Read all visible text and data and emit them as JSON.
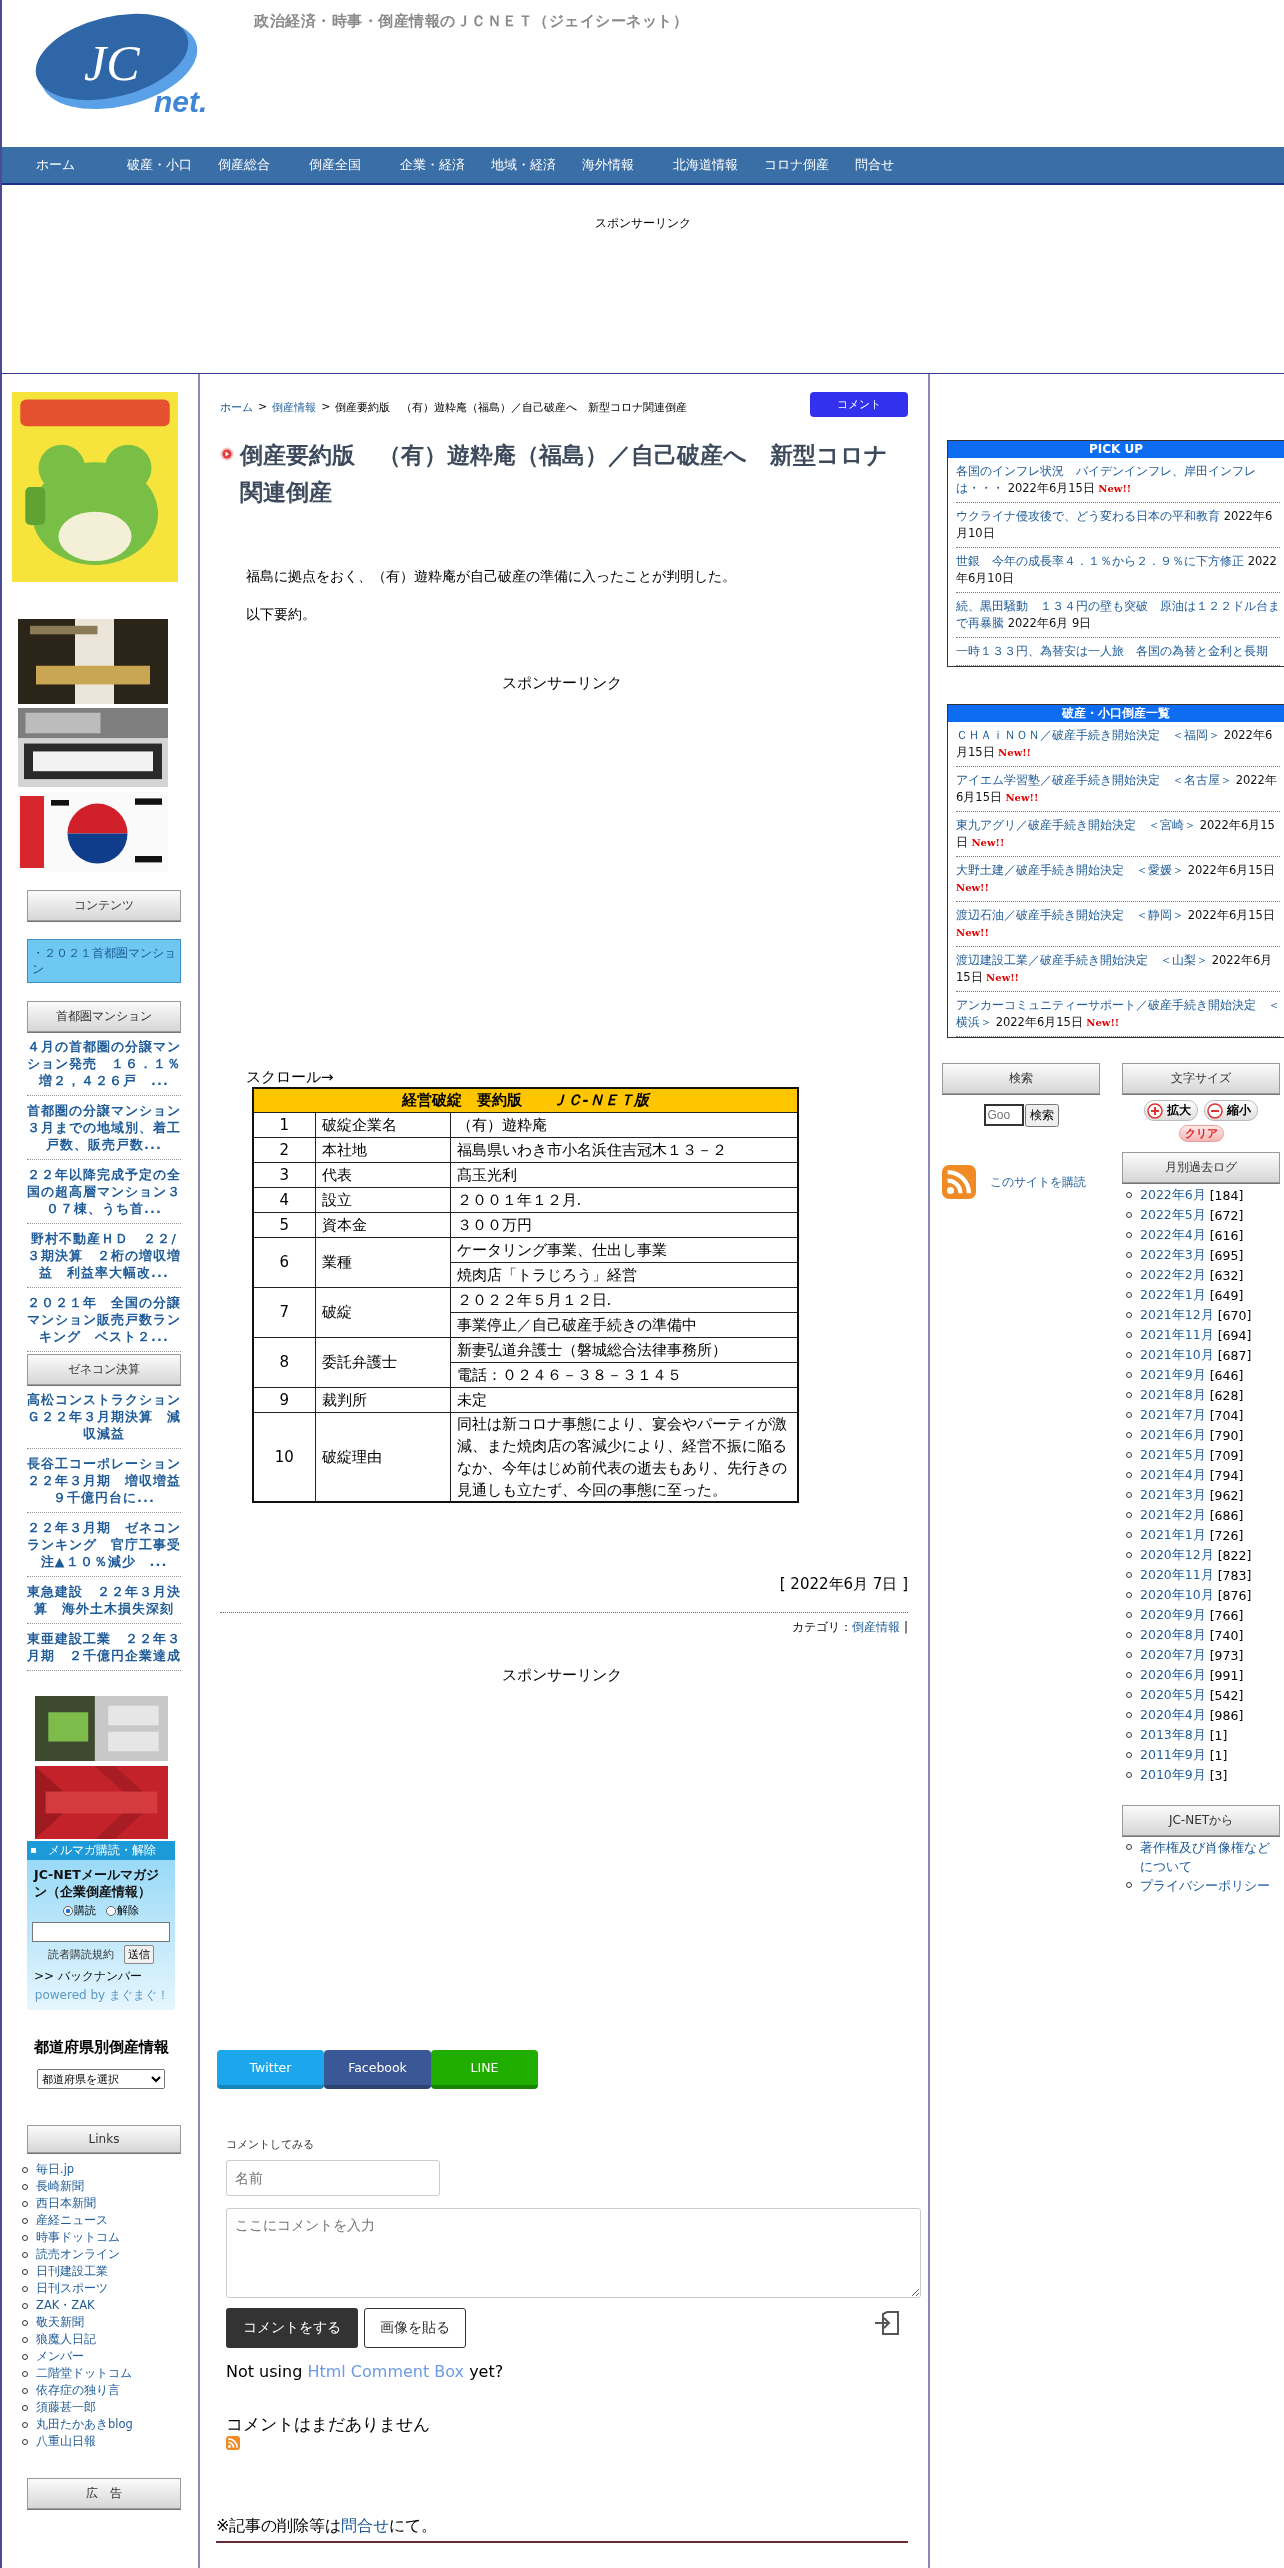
{
  "header": {
    "logo": {
      "mark": "JC",
      "suffix": "net."
    },
    "tagline": "政治経済・時事・倒産情報のＪＣＮＥＴ（ジェイシーネット）"
  },
  "nav": [
    "ホーム",
    "破産・小口",
    "倒産総合",
    "倒産全国",
    "企業・経済",
    "地域・経済",
    "海外情報",
    "北海道情報",
    "コロナ倒産",
    "問合せ"
  ],
  "top_sponsor": "スポンサーリンク",
  "left_sidebar": {
    "contents": {
      "heading": "コンテンツ",
      "items": [
        "・２０２１首都圏マンション"
      ]
    },
    "mansion": {
      "heading": "首都圏マンション",
      "items": [
        "４月の首都圏の分譲マンション発売　１６．１％増２，４２６戸　...",
        "首都圏の分譲マンション３月までの地域別、着工戸数、販売戸数...",
        "２２年以降完成予定の全国の超高層マンション３０７棟、うち首...",
        "野村不動産ＨＤ　２２/３期決算　２桁の増収増益　利益率大幅改...",
        "２０２１年　全国の分譲マンション販売戸数ランキング　ベスト２..."
      ]
    },
    "zenecon": {
      "heading": "ゼネコン決算",
      "items": [
        "高松コンストラクションＧ２２年３月期決算　減収減益",
        "長谷工コーポレーション２２年３月期　増収増益９千億円台に...",
        "２２年３月期　ゼネコンランキング　官庁工事受注▲１０％減少　...",
        "東急建設　２２年３月決算　海外土木損失深刻",
        "東亜建設工業　２２年３月期　２千億円企業達成"
      ]
    },
    "mailmag": {
      "header": "メルマガ購読・解除",
      "title": "JC-NETメールマガジン（企業倒産情報）",
      "options": [
        {
          "label": "購読",
          "selected": true
        },
        {
          "label": "解除",
          "selected": false
        }
      ],
      "terms": "読者購読規約",
      "submit": "送信",
      "backnumber": ">> バックナンバー",
      "powered_by": "powered by",
      "powered_link": "まぐまぐ！"
    },
    "prefecture": {
      "title": "都道府県別倒産情報",
      "select": "都道府県を選択"
    },
    "links": {
      "heading": "Links",
      "items": [
        "毎日.jp",
        "長崎新聞",
        "西日本新聞",
        "産経ニュース",
        "時事ドットコム",
        "読売オンライン",
        "日刊建設工業",
        "日刊スポーツ",
        "ZAK・ZAK",
        "敬天新聞",
        "狼魔人日記",
        "メンバー",
        "二階堂ドットコム",
        "依存症の独り言",
        "須藤甚一郎",
        "丸田たかあきblog",
        "八重山日報"
      ]
    },
    "ad_heading": "広　告"
  },
  "article": {
    "breadcrumb": [
      {
        "kind": "link",
        "text": "ホーム"
      },
      {
        "kind": "separator",
        "text": ">"
      },
      {
        "kind": "link",
        "text": "倒産情報"
      },
      {
        "kind": "separator",
        "text": ">"
      },
      {
        "kind": "current",
        "text": "倒産要約版　（有）遊粋庵（福島）／自己破産へ　新型コロナ関連倒産"
      }
    ],
    "comment_button": "コメント",
    "title": "倒産要約版　（有）遊粋庵（福島）／自己破産へ　新型コロナ関連倒産",
    "paragraphs": [
      "福島に拠点をおく、（有）遊粋庵が自己破産の準備に入ったことが判明した。",
      "以下要約。"
    ],
    "sponsor": "スポンサーリンク",
    "scroll_hint": "スクロール→",
    "table": {
      "caption": "経営破綻　要約版　　*ＪＣ-ＮＥＴ版*",
      "rows": [
        {
          "no": "1",
          "label": "破綻企業名",
          "values": [
            "（有）遊粋庵"
          ]
        },
        {
          "no": "2",
          "label": "本社地",
          "values": [
            "福島県いわき市小名浜住吉冠木１３－２"
          ]
        },
        {
          "no": "3",
          "label": "代表",
          "values": [
            "髙玉光利"
          ]
        },
        {
          "no": "4",
          "label": "設立",
          "values": [
            "２００１年１２月."
          ]
        },
        {
          "no": "5",
          "label": "資本金",
          "values": [
            "３００万円"
          ]
        },
        {
          "no": "6",
          "label": "業種",
          "values": [
            "ケータリング事業、仕出し事業",
            "焼肉店「トラじろう」経営"
          ]
        },
        {
          "no": "7",
          "label": "破綻",
          "values": [
            "２０２２年５月１２日.",
            "事業停止／自己破産手続きの準備中"
          ]
        },
        {
          "no": "8",
          "label": "委託弁護士",
          "values": [
            "新妻弘道弁護士（磐城総合法律事務所）",
            "電話：０２４６－３８－３１４５"
          ]
        },
        {
          "no": "9",
          "label": "裁判所",
          "values": [
            "未定"
          ]
        },
        {
          "no": "10",
          "label": "破綻理由",
          "values": [
            "同社は新コロナ事態により、宴会やパーティが激減、また焼肉店の客減少により、経営不振に陥るなか、今年はじめ前代表の逝去もあり、先行きの見通しも立たず、今回の事態に至った。"
          ]
        }
      ]
    },
    "date": "[ 2022年6月 7日 ]",
    "category": {
      "label": "カテゴリ：",
      "link": "倒産情報",
      "separator": "|"
    },
    "sponsor_bottom": "スポンサーリンク",
    "share": [
      {
        "kind": "twitter",
        "label": "Twitter"
      },
      {
        "kind": "facebook",
        "label": "Facebook"
      },
      {
        "kind": "line",
        "label": "LINE"
      }
    ],
    "comment_form": {
      "heading": "コメントしてみる",
      "name_placeholder": "名前",
      "text_placeholder": "ここにコメントを入力",
      "submit": "コメントをする",
      "image": "画像を貼る",
      "promo_before": "Not using",
      "promo_link": "Html Comment Box",
      "promo_after": "yet?",
      "empty": "コメントはまだありません"
    },
    "footer_note": {
      "before": "※記事の削除等は",
      "link": "問合せ",
      "after": "にて。"
    }
  },
  "right_sidebar": {
    "pickup": {
      "heading": "PICK UP",
      "items": [
        {
          "title": "各国のインフレ状況　バイデンインフレ、岸田インフレは・・・",
          "date": "2022年6月15日",
          "badge": "New!!"
        },
        {
          "title": "ウクライナ侵攻後で、どう変わる日本の平和教育",
          "date": "2022年6月10日"
        },
        {
          "title": "世銀　今年の成長率４．１％から２．９％に下方修正",
          "date": "2022年6月10日"
        },
        {
          "title": "続、黒田騒動　１３４円の壁も突破　原油は１２２ドル台まで再暴騰",
          "date": "2022年6月 9日"
        },
        {
          "title": "一時１３３円、為替安は一人旅　各国の為替と金利と長期"
        }
      ]
    },
    "bankruptcy": {
      "heading": "破産・小口倒産一覧",
      "items": [
        {
          "title": "ＣＨＡｉＮＯＮ／破産手続き開始決定　＜福岡＞",
          "date": "2022年6月15日",
          "badge": "New!!"
        },
        {
          "title": "アイエム学習塾／破産手続き開始決定　＜名古屋＞",
          "date": "2022年6月15日",
          "badge": "New!!"
        },
        {
          "title": "東九アグリ／破産手続き開始決定　＜宮崎＞",
          "date": "2022年6月15日",
          "badge": "New!!"
        },
        {
          "title": "大野土建／破産手続き開始決定　＜愛媛＞",
          "date": "2022年6月15日",
          "badge": "New!!"
        },
        {
          "title": "渡辺石油／破産手続き開始決定　＜静岡＞",
          "date": "2022年6月15日",
          "badge": "New!!"
        },
        {
          "title": "渡辺建設工業／破産手続き開始決定　＜山梨＞",
          "date": "2022年6月15日",
          "badge": "New!!"
        },
        {
          "title": "アンカーコミュニティーサポート／破産手続き開始決定　＜横浜＞",
          "date": "2022年6月15日",
          "badge": "New!!"
        }
      ]
    },
    "search": {
      "heading": "検索",
      "placeholder": "Goo",
      "button": "検索"
    },
    "rss": "このサイトを購読",
    "font_size": {
      "heading": "文字サイズ",
      "enlarge": "拡大",
      "shrink": "縮小",
      "clear": "クリア"
    },
    "archive": {
      "heading": "月別過去ログ",
      "items": [
        {
          "month": "2022年6月",
          "count": "[184]"
        },
        {
          "month": "2022年5月",
          "count": "[672]"
        },
        {
          "month": "2022年4月",
          "count": "[616]"
        },
        {
          "month": "2022年3月",
          "count": "[695]"
        },
        {
          "month": "2022年2月",
          "count": "[632]"
        },
        {
          "month": "2022年1月",
          "count": "[649]"
        },
        {
          "month": "2021年12月",
          "count": "[670]"
        },
        {
          "month": "2021年11月",
          "count": "[694]"
        },
        {
          "month": "2021年10月",
          "count": "[687]"
        },
        {
          "month": "2021年9月",
          "count": "[646]"
        },
        {
          "month": "2021年8月",
          "count": "[628]"
        },
        {
          "month": "2021年7月",
          "count": "[704]"
        },
        {
          "month": "2021年6月",
          "count": "[790]"
        },
        {
          "month": "2021年5月",
          "count": "[709]"
        },
        {
          "month": "2021年4月",
          "count": "[794]"
        },
        {
          "month": "2021年3月",
          "count": "[962]"
        },
        {
          "month": "2021年2月",
          "count": "[686]"
        },
        {
          "month": "2021年1月",
          "count": "[726]"
        },
        {
          "month": "2020年12月",
          "count": "[822]"
        },
        {
          "month": "2020年11月",
          "count": "[783]"
        },
        {
          "month": "2020年10月",
          "count": "[876]"
        },
        {
          "month": "2020年9月",
          "count": "[766]"
        },
        {
          "month": "2020年8月",
          "count": "[740]"
        },
        {
          "month": "2020年7月",
          "count": "[973]"
        },
        {
          "month": "2020年6月",
          "count": "[991]"
        },
        {
          "month": "2020年5月",
          "count": "[542]"
        },
        {
          "month": "2020年4月",
          "count": "[986]"
        },
        {
          "month": "2013年8月",
          "count": "[1]"
        },
        {
          "month": "2011年9月",
          "count": "[1]"
        },
        {
          "month": "2010年9月",
          "count": "[3]"
        }
      ]
    },
    "about": {
      "heading": "JC-NETから",
      "items": [
        "著作権及び肖像権などについて",
        "プライバシーポリシー"
      ]
    }
  }
}
